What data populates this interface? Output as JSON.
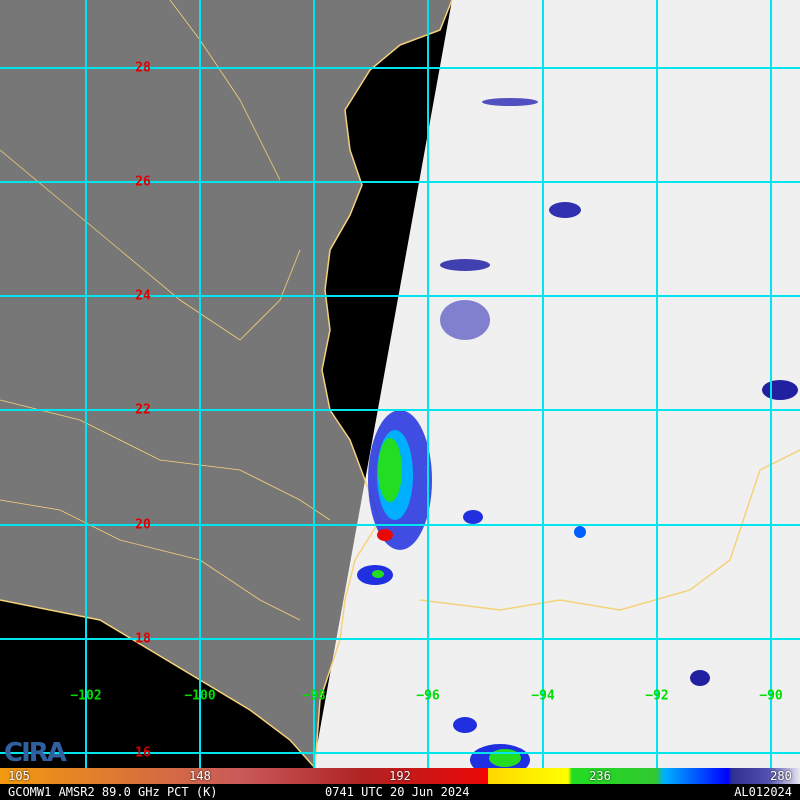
{
  "logo": "CIRA",
  "latitude_labels": [
    "28",
    "26",
    "24",
    "22",
    "20",
    "18",
    "16"
  ],
  "longitude_labels": [
    "−102",
    "−100",
    "−98",
    "−96",
    "−94",
    "−92",
    "−90"
  ],
  "colorbar": {
    "ticks": [
      "105",
      "148",
      "192",
      "236",
      "280"
    ],
    "unit": "K"
  },
  "footer": {
    "product": "GCOMW1 AMSR2 89.0 GHz PCT (K)",
    "time": "0741 UTC 20 Jun 2024",
    "storm_id": "AL012024"
  },
  "colors": {
    "grid": "#00e5ee",
    "coast": "#f5d27a",
    "land": "#777777",
    "swath": "#f0f0f0"
  }
}
